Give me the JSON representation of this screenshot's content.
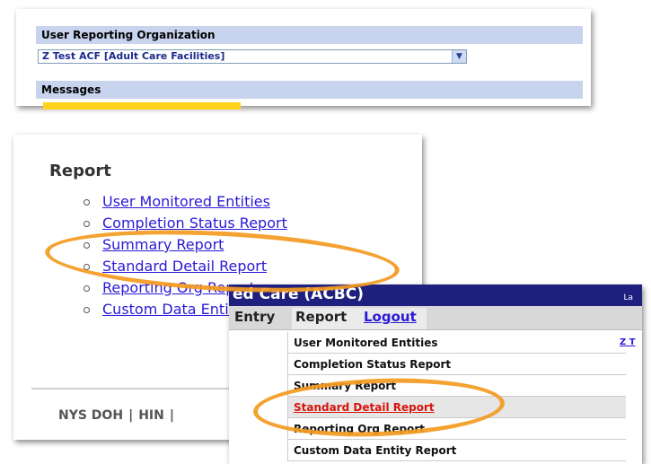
{
  "panel_org": {
    "org_label": "User Reporting Organization",
    "org_select_value": "Z Test ACF [Adult Care Facilities]",
    "messages_label": "Messages"
  },
  "panel_menu": {
    "heading": "Report",
    "items": [
      "User Monitored Entities",
      "Completion Status Report",
      "Summary Report",
      "Standard Detail Report",
      "Reporting Org Report",
      "Custom Data Entity Report"
    ],
    "footer": [
      "NYS DOH",
      "HIN"
    ]
  },
  "panel_dropdown": {
    "title_fragment": "ed Care (ACBC)",
    "title_right": "La",
    "menu": {
      "entry": "Entry",
      "report": "Report",
      "logout": "Logout"
    },
    "side_text": "Z T",
    "items": [
      "User Monitored Entities",
      "Completion Status Report",
      "Summary Report",
      "Standard Detail Report",
      "Reporting Org Report",
      "Custom Data Entity Report"
    ]
  },
  "colors": {
    "header_bar": "#c8d3ee",
    "link": "#2a19d6",
    "highlight_oval": "#f39a20",
    "active_link": "#d8140c",
    "title_bar": "#1f1f80"
  },
  "icons": [
    "dropdown-arrow-icon",
    "bullet-icon"
  ]
}
